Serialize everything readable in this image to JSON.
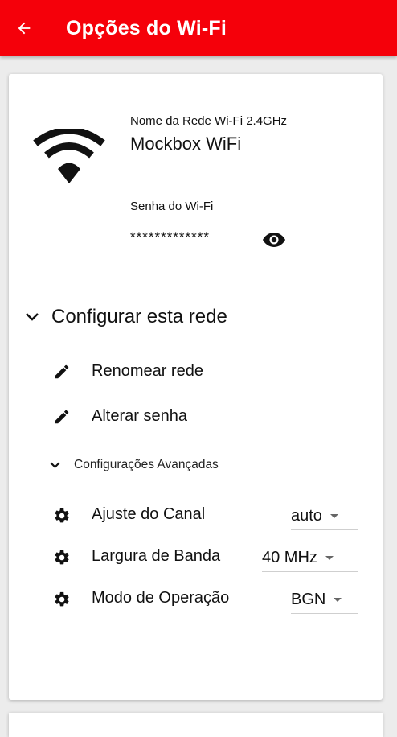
{
  "appbar": {
    "title": "Opções do Wi-Fi",
    "back_icon": "arrow-left-icon"
  },
  "network": {
    "name_label": "Nome da Rede Wi-Fi 2.4GHz",
    "name_value": "Mockbox WiFi",
    "password_label": "Senha do Wi-Fi",
    "password_value": "*************",
    "wifi_icon": "wifi-icon",
    "eye_icon": "eye-icon"
  },
  "configure": {
    "title": "Configurar esta rede",
    "actions": [
      {
        "label": "Renomear rede",
        "icon": "pencil-icon"
      },
      {
        "label": "Alterar senha",
        "icon": "pencil-icon"
      }
    ]
  },
  "advanced": {
    "title": "Configurações Avançadas",
    "settings": [
      {
        "label": "Ajuste do Canal",
        "value": "auto",
        "icon": "gear-icon"
      },
      {
        "label": "Largura de Banda",
        "value": "40 MHz",
        "icon": "gear-icon"
      },
      {
        "label": "Modo de Operação",
        "value": "BGN",
        "icon": "gear-icon"
      }
    ]
  },
  "colors": {
    "appbar": "#f5000a",
    "background": "#ececec",
    "card": "#ffffff",
    "text": "#111111"
  }
}
